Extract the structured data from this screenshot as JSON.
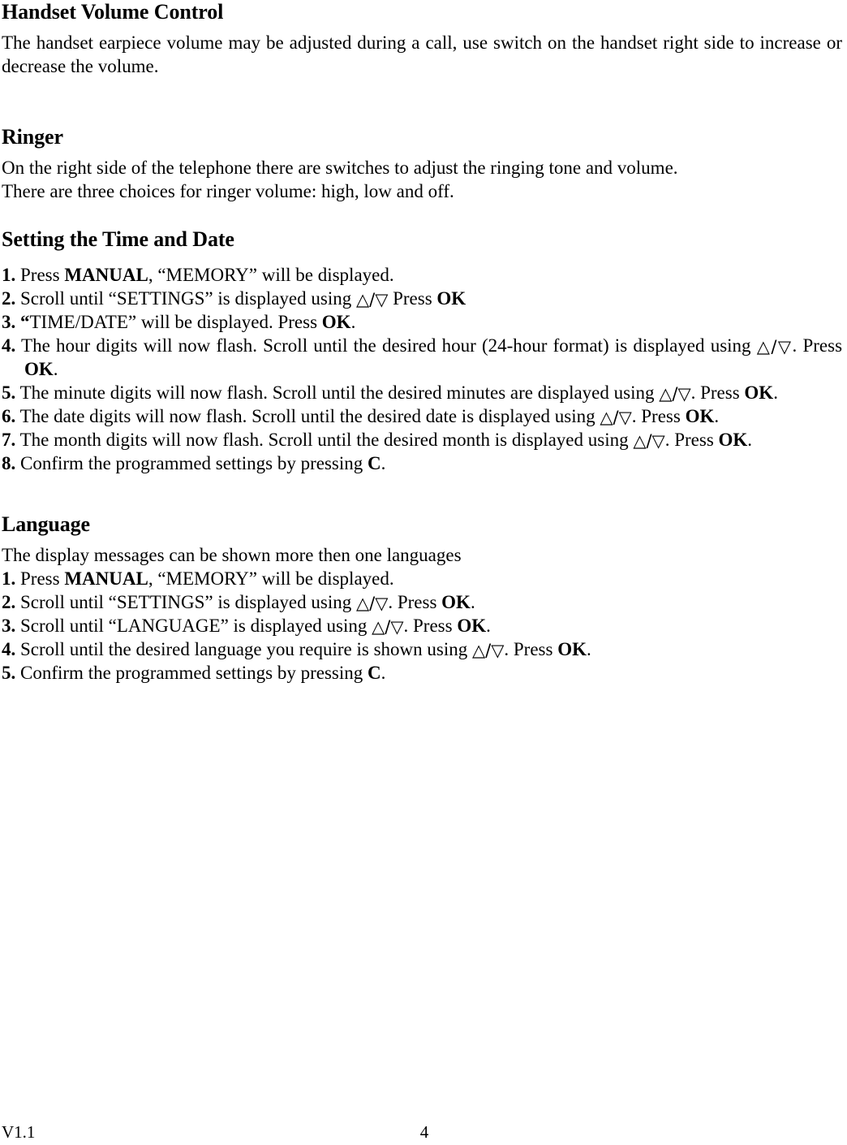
{
  "document": {
    "sections": [
      {
        "heading": "Handset Volume Control",
        "paragraphs": [
          "The handset earpiece volume may be adjusted during a call, use switch on the handset right side to increase or decrease the volume."
        ]
      },
      {
        "heading": "Ringer",
        "paragraphs": [
          "On the right side of the telephone there are switches to adjust the ringing tone and volume.",
          "There are three choices for ringer volume: high, low and off."
        ]
      },
      {
        "heading": "Setting the Time and Date",
        "steps": [
          {
            "num": "1.",
            "parts": [
              {
                "text": " Press ",
                "bold": false
              },
              {
                "text": "MANUAL",
                "bold": true
              },
              {
                "text": ", “MEMORY” will be displayed.",
                "bold": false
              }
            ]
          },
          {
            "num": "2.",
            "parts": [
              {
                "text": " Scroll until “SETTINGS” is displayed using ",
                "bold": false
              },
              {
                "text": "△/▽",
                "triangle": true
              },
              {
                "text": " Press ",
                "bold": false
              },
              {
                "text": "OK",
                "bold": true
              }
            ]
          },
          {
            "num": "3.",
            "parts": [
              {
                "text": " “",
                "bold": true
              },
              {
                "text": "TIME/DATE” will be displayed. Press ",
                "bold": false
              },
              {
                "text": "OK",
                "bold": true
              },
              {
                "text": ".",
                "bold": false
              }
            ]
          },
          {
            "num": "4.",
            "parts": [
              {
                "text": " The hour digits will now flash. Scroll until the desired hour (24-hour format) is displayed using ",
                "bold": false
              },
              {
                "text": "△/▽",
                "triangle": true
              },
              {
                "text": ". Press ",
                "bold": false
              },
              {
                "text": "OK",
                "bold": true
              },
              {
                "text": ".",
                "bold": false
              }
            ]
          },
          {
            "num": "5.",
            "parts": [
              {
                "text": " The minute digits will now flash. Scroll until the desired minutes are displayed using ",
                "bold": false
              },
              {
                "text": "△/▽",
                "triangle": true
              },
              {
                "text": ". Press ",
                "bold": false
              },
              {
                "text": "OK",
                "bold": true
              },
              {
                "text": ".",
                "bold": false
              }
            ]
          },
          {
            "num": "6.",
            "parts": [
              {
                "text": " The date digits will now flash. Scroll until the desired date is displayed using ",
                "bold": false
              },
              {
                "text": "△/▽",
                "triangle": true
              },
              {
                "text": ". Press ",
                "bold": false
              },
              {
                "text": "OK",
                "bold": true
              },
              {
                "text": ".",
                "bold": false
              }
            ]
          },
          {
            "num": "7.",
            "parts": [
              {
                "text": " The month digits will now flash. Scroll until the desired month is displayed using ",
                "bold": false
              },
              {
                "text": "△/▽",
                "triangle": true
              },
              {
                "text": ". Press ",
                "bold": false
              },
              {
                "text": "OK",
                "bold": true
              },
              {
                "text": ".",
                "bold": false
              }
            ]
          },
          {
            "num": "8.",
            "parts": [
              {
                "text": " Confirm the programmed settings by pressing ",
                "bold": false
              },
              {
                "text": "C",
                "bold": true
              },
              {
                "text": ".",
                "bold": false
              }
            ]
          }
        ]
      },
      {
        "heading": "Language",
        "intro": "The display messages can be shown more then one languages",
        "steps": [
          {
            "num": "1.",
            "parts": [
              {
                "text": " Press ",
                "bold": false
              },
              {
                "text": "MANUAL",
                "bold": true
              },
              {
                "text": ", “MEMORY” will be displayed.",
                "bold": false
              }
            ]
          },
          {
            "num": "2.",
            "parts": [
              {
                "text": " Scroll until “SETTINGS” is displayed using ",
                "bold": false
              },
              {
                "text": "△/▽",
                "triangle": true
              },
              {
                "text": ". Press ",
                "bold": false
              },
              {
                "text": "OK",
                "bold": true
              },
              {
                "text": ".",
                "bold": false
              }
            ]
          },
          {
            "num": "3.",
            "parts": [
              {
                "text": " Scroll until “LANGUAGE” is displayed using ",
                "bold": false
              },
              {
                "text": "△/▽",
                "triangle": true
              },
              {
                "text": ". Press ",
                "bold": false
              },
              {
                "text": "OK",
                "bold": true
              },
              {
                "text": ".",
                "bold": false
              }
            ]
          },
          {
            "num": "4.",
            "parts": [
              {
                "text": " Scroll until the desired language you require is shown using ",
                "bold": false
              },
              {
                "text": "△/▽",
                "triangle": true
              },
              {
                "text": ". Press ",
                "bold": false
              },
              {
                "text": "OK",
                "bold": true
              },
              {
                "text": ".",
                "bold": false
              }
            ]
          },
          {
            "num": "5.",
            "parts": [
              {
                "text": " Confirm the programmed settings by pressing ",
                "bold": false
              },
              {
                "text": "C",
                "bold": true
              },
              {
                "text": ".",
                "bold": false
              }
            ]
          }
        ]
      }
    ],
    "footer": {
      "version": "V1.1",
      "page_number": "4"
    }
  }
}
